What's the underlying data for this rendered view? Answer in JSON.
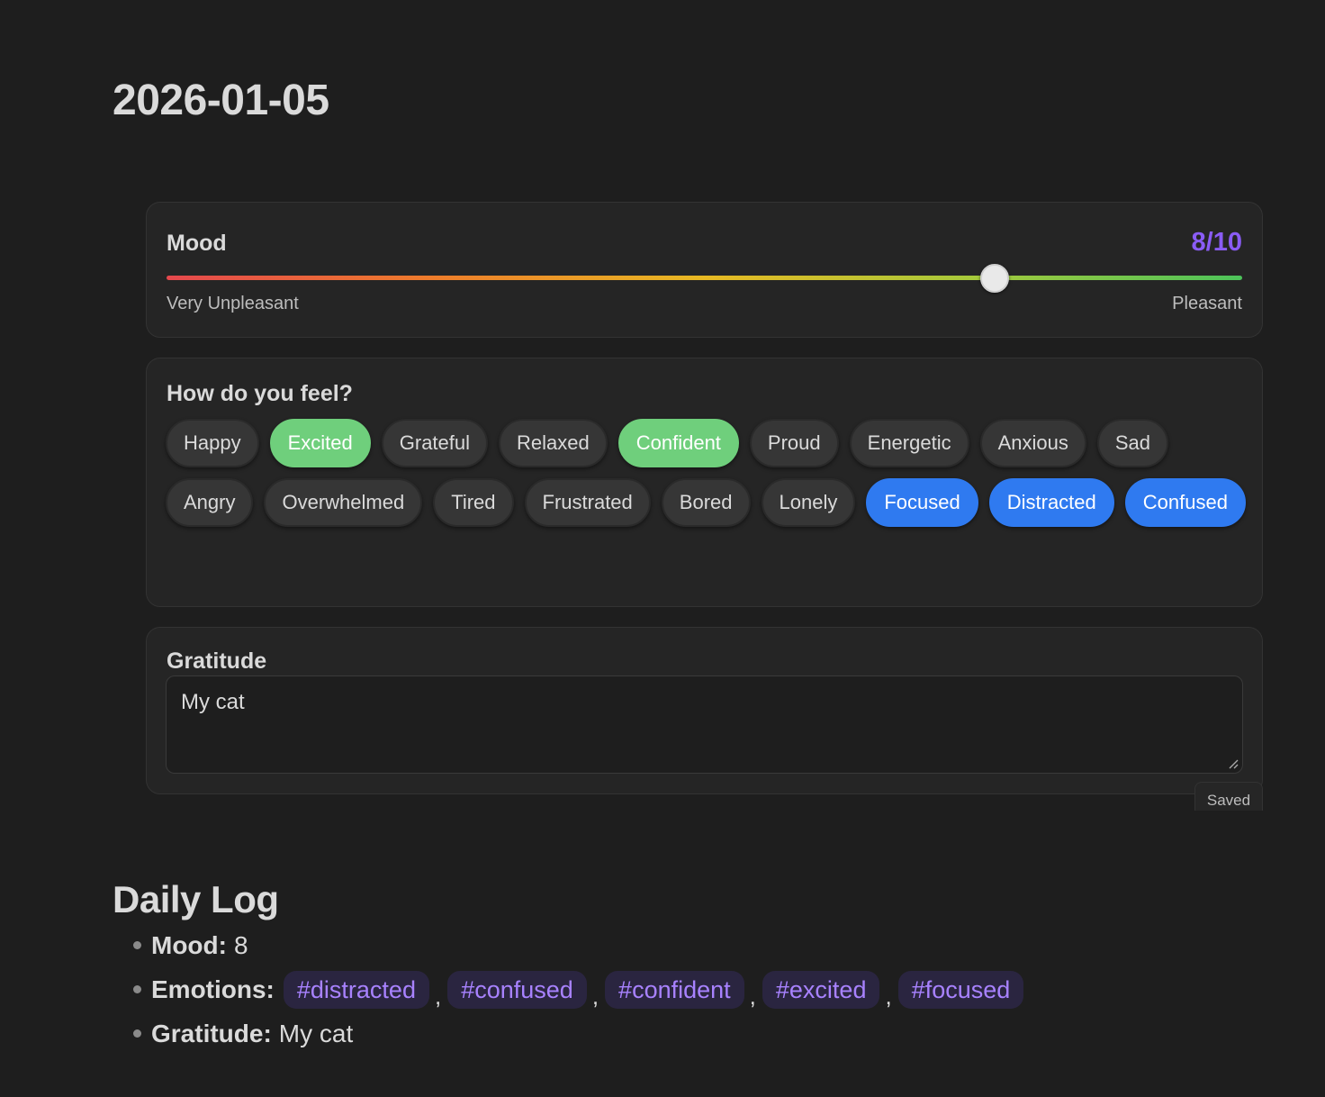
{
  "page": {
    "title": "2026-01-05"
  },
  "mood": {
    "label": "Mood",
    "value_text": "8/10",
    "value": 8,
    "max": 10,
    "min_label": "Very Unpleasant",
    "max_label": "Pleasant",
    "value_color": "#8a5cf5"
  },
  "feel": {
    "title": "How do you feel?",
    "chips": [
      {
        "label": "Happy",
        "state": "off"
      },
      {
        "label": "Excited",
        "state": "green"
      },
      {
        "label": "Grateful",
        "state": "off"
      },
      {
        "label": "Relaxed",
        "state": "off"
      },
      {
        "label": "Confident",
        "state": "green"
      },
      {
        "label": "Proud",
        "state": "off"
      },
      {
        "label": "Energetic",
        "state": "off"
      },
      {
        "label": "Anxious",
        "state": "off"
      },
      {
        "label": "Sad",
        "state": "off"
      },
      {
        "label": "Angry",
        "state": "off"
      },
      {
        "label": "Overwhelmed",
        "state": "off"
      },
      {
        "label": "Tired",
        "state": "off"
      },
      {
        "label": "Frustrated",
        "state": "off"
      },
      {
        "label": "Bored",
        "state": "off"
      },
      {
        "label": "Lonely",
        "state": "off"
      },
      {
        "label": "Focused",
        "state": "blue"
      },
      {
        "label": "Distracted",
        "state": "blue"
      },
      {
        "label": "Confused",
        "state": "blue"
      }
    ],
    "colors": {
      "green": "#6fcf7c",
      "blue": "#2f7af0",
      "off": "#363636"
    }
  },
  "gratitude": {
    "title": "Gratitude",
    "value": "My cat",
    "status": "Saved"
  },
  "daily_log": {
    "title": "Daily Log",
    "mood_key": "Mood:",
    "mood_val": "8",
    "emotions_key": "Emotions:",
    "emotions": [
      "#distracted",
      "#confused",
      "#confident",
      "#excited",
      "#focused"
    ],
    "separator": ",",
    "gratitude_key": "Gratitude:",
    "gratitude_val": "My cat",
    "tag_color": "#a882ff"
  }
}
